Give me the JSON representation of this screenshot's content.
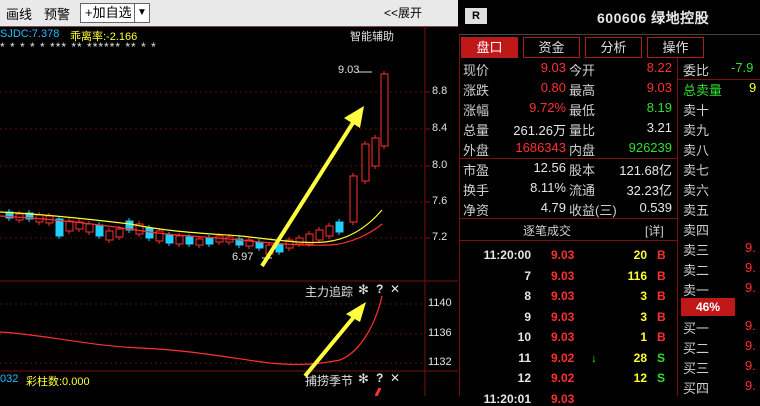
{
  "toolbar": {
    "items": [
      "画线",
      "预警"
    ],
    "add_label": "+加自选",
    "dropdown_glyph": "▼",
    "expand_label": "<<展开"
  },
  "chart": {
    "indicator_left": "SJDC:7.378",
    "indicator_mid": "乖离率:-2.166",
    "smart_label": "智能辅助",
    "star_row": "*    *    *    *    *  ***  **  ****** **  *  *",
    "price_high_label": "9.03",
    "price_low_label": "6.97",
    "y_ticks": [
      "8.8",
      "8.4",
      "8.0",
      "7.6",
      "7.2"
    ],
    "panel2_title": "主力追踪",
    "panel2_ticks": [
      "1140",
      "1136",
      "1132"
    ],
    "panel3_title": "捕捞季节",
    "panel3_left": "032",
    "panel3_indicator": "彩柱数:0.000",
    "gear_glyph": "✻",
    "help_glyph": "?",
    "close_glyph": "✕",
    "colors": {
      "up": "#ff3030",
      "down": "#20d0ff",
      "ma_yellow": "#ffff30",
      "ma_red": "#ff3030",
      "arrow": "#ffff40"
    }
  },
  "chart_data": {
    "type": "candlestick",
    "price_axis": {
      "ticks": [
        8.8,
        8.4,
        8.0,
        7.6,
        7.2
      ]
    },
    "last_high": 9.03,
    "recent_low": 6.97,
    "series": [
      {
        "name": "SJDC",
        "value": 7.378
      },
      {
        "name": "乖离率",
        "value": -2.166
      }
    ],
    "sub_panels": [
      {
        "name": "主力追踪",
        "ticks": [
          1140,
          1136,
          1132
        ]
      },
      {
        "name": "捕捞季节",
        "values": [
          {
            "label": "彩柱数",
            "value": 0.0
          }
        ]
      }
    ]
  },
  "stock": {
    "badge": "R",
    "title": "600606 绿地控股",
    "tabs": [
      "盘口",
      "资金",
      "分析",
      "操作"
    ]
  },
  "quote": {
    "rows": [
      [
        {
          "l": "现价",
          "v": "9.03",
          "c": "red"
        },
        {
          "l": "今开",
          "v": "8.22",
          "c": "red"
        }
      ],
      [
        {
          "l": "涨跌",
          "v": "0.80",
          "c": "red"
        },
        {
          "l": "最高",
          "v": "9.03",
          "c": "red"
        }
      ],
      [
        {
          "l": "涨幅",
          "v": "9.72%",
          "c": "red"
        },
        {
          "l": "最低",
          "v": "8.19",
          "c": "green"
        }
      ],
      [
        {
          "l": "总量",
          "v": "261.26万",
          "c": "white"
        },
        {
          "l": "量比",
          "v": "3.21",
          "c": "white"
        }
      ],
      [
        {
          "l": "外盘",
          "v": "1686343",
          "c": "red"
        },
        {
          "l": "内盘",
          "v": "926239",
          "c": "green"
        }
      ],
      [
        {
          "l": "市盈",
          "v": "12.56",
          "c": "white"
        },
        {
          "l": "股本",
          "v": "121.68亿",
          "c": "white"
        }
      ],
      [
        {
          "l": "换手",
          "v": "8.11%",
          "c": "white"
        },
        {
          "l": "流通",
          "v": "32.23亿",
          "c": "white"
        }
      ],
      [
        {
          "l": "净资",
          "v": "4.79",
          "c": "white"
        },
        {
          "l": "收益(三)",
          "v": "0.539",
          "c": "white"
        }
      ]
    ]
  },
  "trades": {
    "title": "逐笔成交",
    "detail_label": "[详]",
    "rows": [
      {
        "time": "11:20:00",
        "price": "9.03",
        "arrow": "",
        "vol": "20",
        "bs": "B",
        "pc": "red",
        "bc": "red"
      },
      {
        "time": "7",
        "price": "9.03",
        "arrow": "",
        "vol": "116",
        "bs": "B",
        "pc": "red",
        "bc": "red"
      },
      {
        "time": "8",
        "price": "9.03",
        "arrow": "",
        "vol": "3",
        "bs": "B",
        "pc": "red",
        "bc": "red"
      },
      {
        "time": "9",
        "price": "9.03",
        "arrow": "",
        "vol": "3",
        "bs": "B",
        "pc": "red",
        "bc": "red"
      },
      {
        "time": "10",
        "price": "9.03",
        "arrow": "",
        "vol": "1",
        "bs": "B",
        "pc": "red",
        "bc": "red"
      },
      {
        "time": "11",
        "price": "9.02",
        "arrow": "↓",
        "vol": "28",
        "bs": "S",
        "pc": "red",
        "bc": "green"
      },
      {
        "time": "12",
        "price": "9.02",
        "arrow": "",
        "vol": "12",
        "bs": "S",
        "pc": "red",
        "bc": "green"
      },
      {
        "time": "11:20:01",
        "price": "9.03",
        "arrow": "",
        "vol": "",
        "bs": "",
        "pc": "red",
        "bc": "red"
      }
    ]
  },
  "orderbook": {
    "commit_label": "委比",
    "commit_value": "-7.9",
    "total_sell_label": "总卖量",
    "total_sell_value": "9",
    "pct": "46%",
    "sells": [
      {
        "l": "卖十",
        "v": ""
      },
      {
        "l": "卖九",
        "v": ""
      },
      {
        "l": "卖八",
        "v": ""
      },
      {
        "l": "卖七",
        "v": ""
      },
      {
        "l": "卖六",
        "v": ""
      },
      {
        "l": "卖五",
        "v": ""
      },
      {
        "l": "卖四",
        "v": ""
      },
      {
        "l": "卖三",
        "v": "9."
      },
      {
        "l": "卖二",
        "v": "9."
      },
      {
        "l": "卖一",
        "v": "9."
      }
    ],
    "buys": [
      {
        "l": "买一",
        "v": "9."
      },
      {
        "l": "买二",
        "v": "9."
      },
      {
        "l": "买三",
        "v": "9."
      },
      {
        "l": "买四",
        "v": "9."
      }
    ]
  }
}
